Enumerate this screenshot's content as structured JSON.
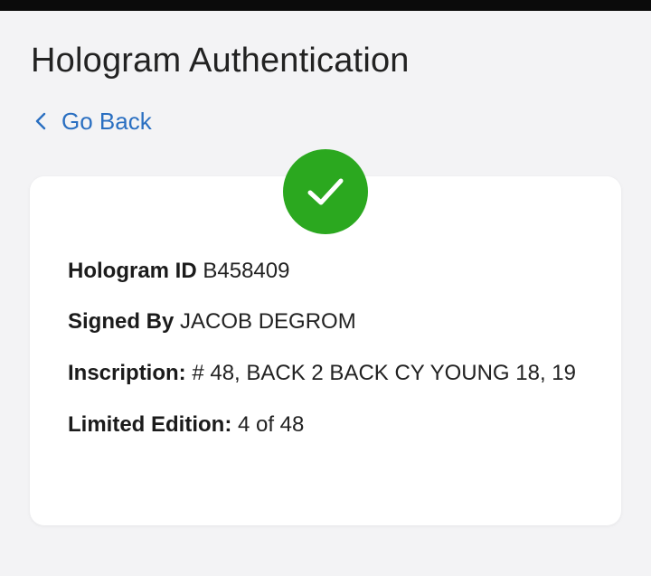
{
  "page": {
    "title": "Hologram Authentication"
  },
  "nav": {
    "back_label": "Go Back"
  },
  "status": {
    "icon": "checkmark-icon",
    "color": "#2ba81f"
  },
  "details": {
    "hologram_id": {
      "label": "Hologram ID",
      "value": "B458409"
    },
    "signed_by": {
      "label": "Signed By",
      "value": "JACOB DEGROM"
    },
    "inscription": {
      "label": "Inscription:",
      "value": "# 48, BACK 2 BACK CY YOUNG 18, 19"
    },
    "limited_edition": {
      "label": "Limited Edition:",
      "value": "4 of 48"
    }
  },
  "colors": {
    "link": "#2a6fc1",
    "background": "#f3f3f5",
    "card": "#ffffff"
  }
}
